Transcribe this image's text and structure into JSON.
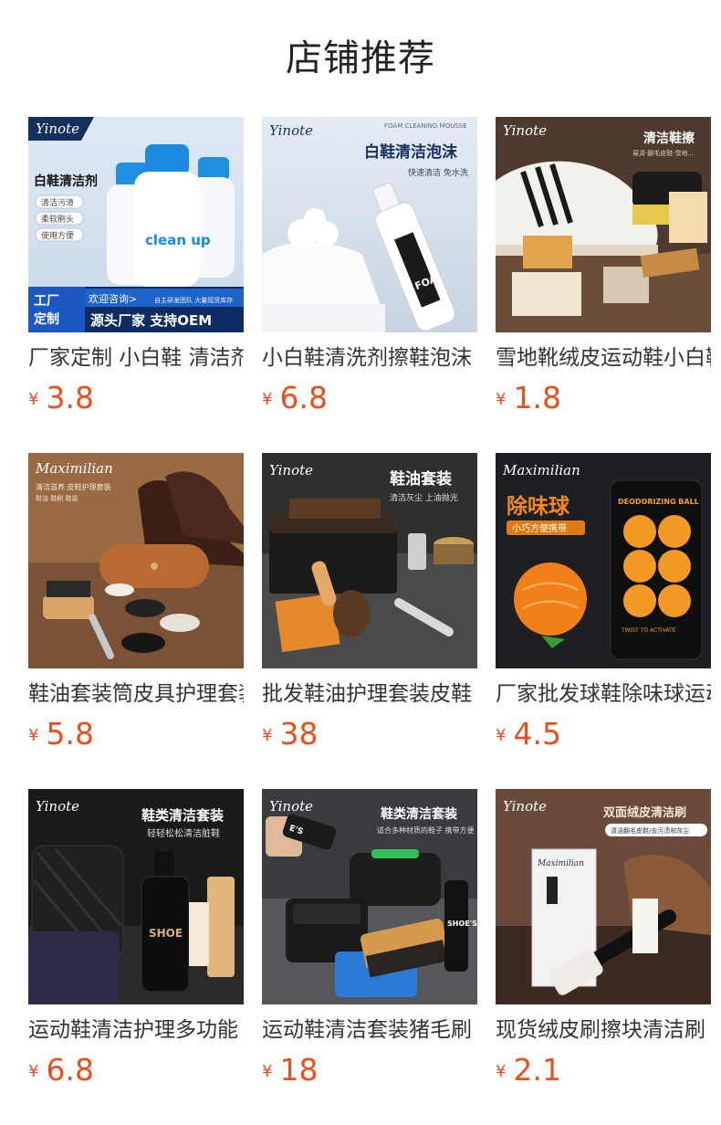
{
  "header": {
    "title": "店铺推荐"
  },
  "colors": {
    "price": "#e8501c",
    "title": "#222222",
    "name": "#333333"
  },
  "products": [
    {
      "name": "厂家定制 小白鞋 清洁剂",
      "currency": "¥",
      "price": "3.8",
      "image": {
        "brand": "Yinote",
        "headline": "白鞋清洁剂",
        "tags": [
          "清洁污渍",
          "柔软刷头",
          "使用方便"
        ],
        "bottle_text": "clean up",
        "badge": "工厂定制",
        "promo": "欢迎咨询>",
        "promo_small": "自主研发团队 大量现货库存",
        "slogan": "源头厂家  支持OEM"
      }
    },
    {
      "name": "小白鞋清洗剂擦鞋泡沫",
      "currency": "¥",
      "price": "6.8",
      "image": {
        "brand": "Yinote",
        "small": "FOAM CLEANING MOUSSE",
        "headline": "白鞋清洁泡沫",
        "sub": "快速清洁 免水洗"
      }
    },
    {
      "name": "雪地靴绒皮运动鞋小白鞋",
      "currency": "¥",
      "price": "1.8",
      "image": {
        "brand": "Yinote",
        "headline": "清洁鞋擦",
        "sub": "易清·翻毛皮鞋·雪地..."
      }
    },
    {
      "name": "鞋油套装筒皮具护理套装",
      "currency": "¥",
      "price": "5.8",
      "image": {
        "brand": "Maximilian",
        "headline": "清洁滋养  皮鞋护理套装",
        "sub": "鞋油 鞋刷 鞋拔"
      }
    },
    {
      "name": "批发鞋油护理套装皮鞋",
      "currency": "¥",
      "price": "38",
      "image": {
        "brand": "Yinote",
        "headline": "鞋油套装",
        "sub": "清洁灰尘  上油抛光"
      }
    },
    {
      "name": "厂家批发球鞋除味球运动",
      "currency": "¥",
      "price": "4.5",
      "image": {
        "brand": "Maximilian",
        "headline": "除味球",
        "sub": "小巧方便携带",
        "package": "DEODORIZING BALL",
        "package_small": "TWIST TO ACTIVATE"
      }
    },
    {
      "name": "运动鞋清洁护理多功能",
      "currency": "¥",
      "price": "6.8",
      "image": {
        "brand": "Yinote",
        "headline": "鞋类清洁套装",
        "sub": "轻轻松松清洁脏鞋",
        "bottle": "SHOE"
      }
    },
    {
      "name": "运动鞋清洁套装猪毛刷",
      "currency": "¥",
      "price": "18",
      "image": {
        "brand": "Yinote",
        "headline": "鞋类清洁套装",
        "sub": "适合多种材质的鞋子 携带方便",
        "bottle": "SHOE'S"
      }
    },
    {
      "name": "现货绒皮刷擦块清洁刷",
      "currency": "¥",
      "price": "2.1",
      "image": {
        "brand": "Yinote",
        "headline": "双面绒皮清洁刷",
        "sub": "清洁翻毛皮鞋/去污渍和灰尘",
        "box_brand": "Maximilian"
      }
    }
  ]
}
